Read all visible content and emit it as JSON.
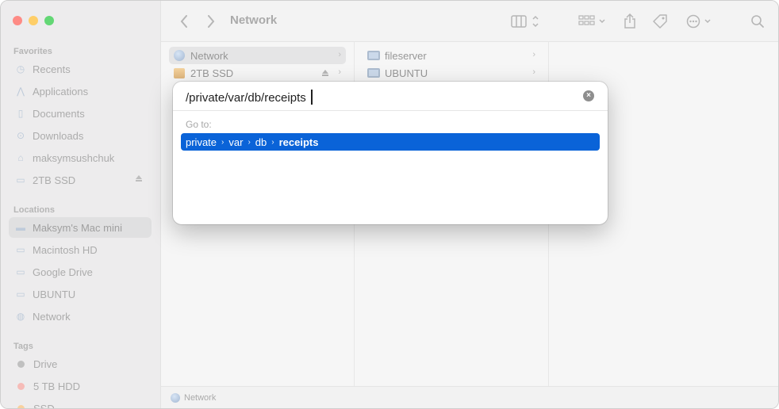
{
  "window": {
    "title": "Network"
  },
  "sidebar": {
    "favorites_label": "Favorites",
    "favorites": [
      {
        "label": "Recents",
        "icon": "clock-icon"
      },
      {
        "label": "Applications",
        "icon": "applications-icon"
      },
      {
        "label": "Documents",
        "icon": "document-icon"
      },
      {
        "label": "Downloads",
        "icon": "downloads-icon"
      },
      {
        "label": "maksymsushchuk",
        "icon": "home-icon"
      },
      {
        "label": "2TB SSD",
        "icon": "drive-icon"
      }
    ],
    "locations_label": "Locations",
    "locations": [
      {
        "label": "Maksym's Mac mini",
        "icon": "mac-mini-icon"
      },
      {
        "label": "Macintosh HD",
        "icon": "drive-icon"
      },
      {
        "label": "Google Drive",
        "icon": "drive-icon"
      },
      {
        "label": "UBUNTU",
        "icon": "monitor-icon"
      },
      {
        "label": "Network",
        "icon": "globe-icon"
      }
    ],
    "tags_label": "Tags",
    "tags": [
      {
        "label": "Drive",
        "color": "#9a9a9a"
      },
      {
        "label": "5 TB HDD",
        "color": "#f08a84"
      },
      {
        "label": "SSD",
        "color": "#f5b25a"
      }
    ]
  },
  "column1": {
    "items": [
      {
        "label": "Network"
      },
      {
        "label": "2TB SSD"
      }
    ]
  },
  "column2": {
    "items": [
      {
        "label": "fileserver"
      },
      {
        "label": "UBUNTU"
      }
    ]
  },
  "statusbar": {
    "path": "Network"
  },
  "goto_dialog": {
    "input_value": "/private/var/db/receipts",
    "goto_label": "Go to:",
    "suggestion": {
      "segments": [
        "private",
        "var",
        "db"
      ],
      "last": "receipts"
    },
    "accent_color": "#0a63d8"
  }
}
